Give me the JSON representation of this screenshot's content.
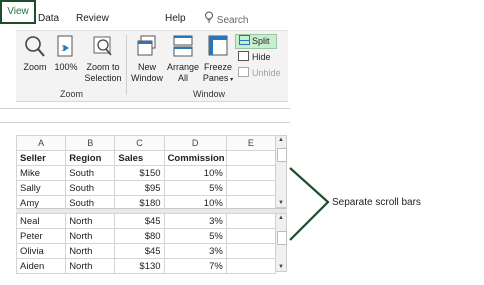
{
  "tabs": [
    "Data",
    "Review",
    "View",
    "Help"
  ],
  "search": "Search",
  "ribbon": {
    "zoom_group": {
      "label": "Zoom",
      "buttons": [
        "Zoom",
        "100%",
        "Zoom to Selection"
      ]
    },
    "window_group": {
      "label": "Window",
      "buttons": [
        "New Window",
        "Arrange All",
        "Freeze Panes"
      ],
      "small": [
        "Split",
        "Hide",
        "Unhide"
      ]
    }
  },
  "columns": [
    "A",
    "B",
    "C",
    "D",
    "E"
  ],
  "header": [
    "Seller",
    "Region",
    "Sales",
    "Commission"
  ],
  "top_rows": [
    [
      "Mike",
      "South",
      "$150",
      "10%"
    ],
    [
      "Sally",
      "South",
      "$95",
      "5%"
    ],
    [
      "Amy",
      "South",
      "$180",
      "10%"
    ]
  ],
  "bottom_rows": [
    [
      "Neal",
      "North",
      "$45",
      "3%"
    ],
    [
      "Peter",
      "North",
      "$80",
      "5%"
    ],
    [
      "Olivia",
      "North",
      "$45",
      "3%"
    ],
    [
      "Aiden",
      "North",
      "$130",
      "7%"
    ]
  ],
  "annotation": "Separate scroll bars",
  "colors": {
    "accent": "#217346",
    "highlight": "#c6efce",
    "callout": "#1e4d2b"
  }
}
